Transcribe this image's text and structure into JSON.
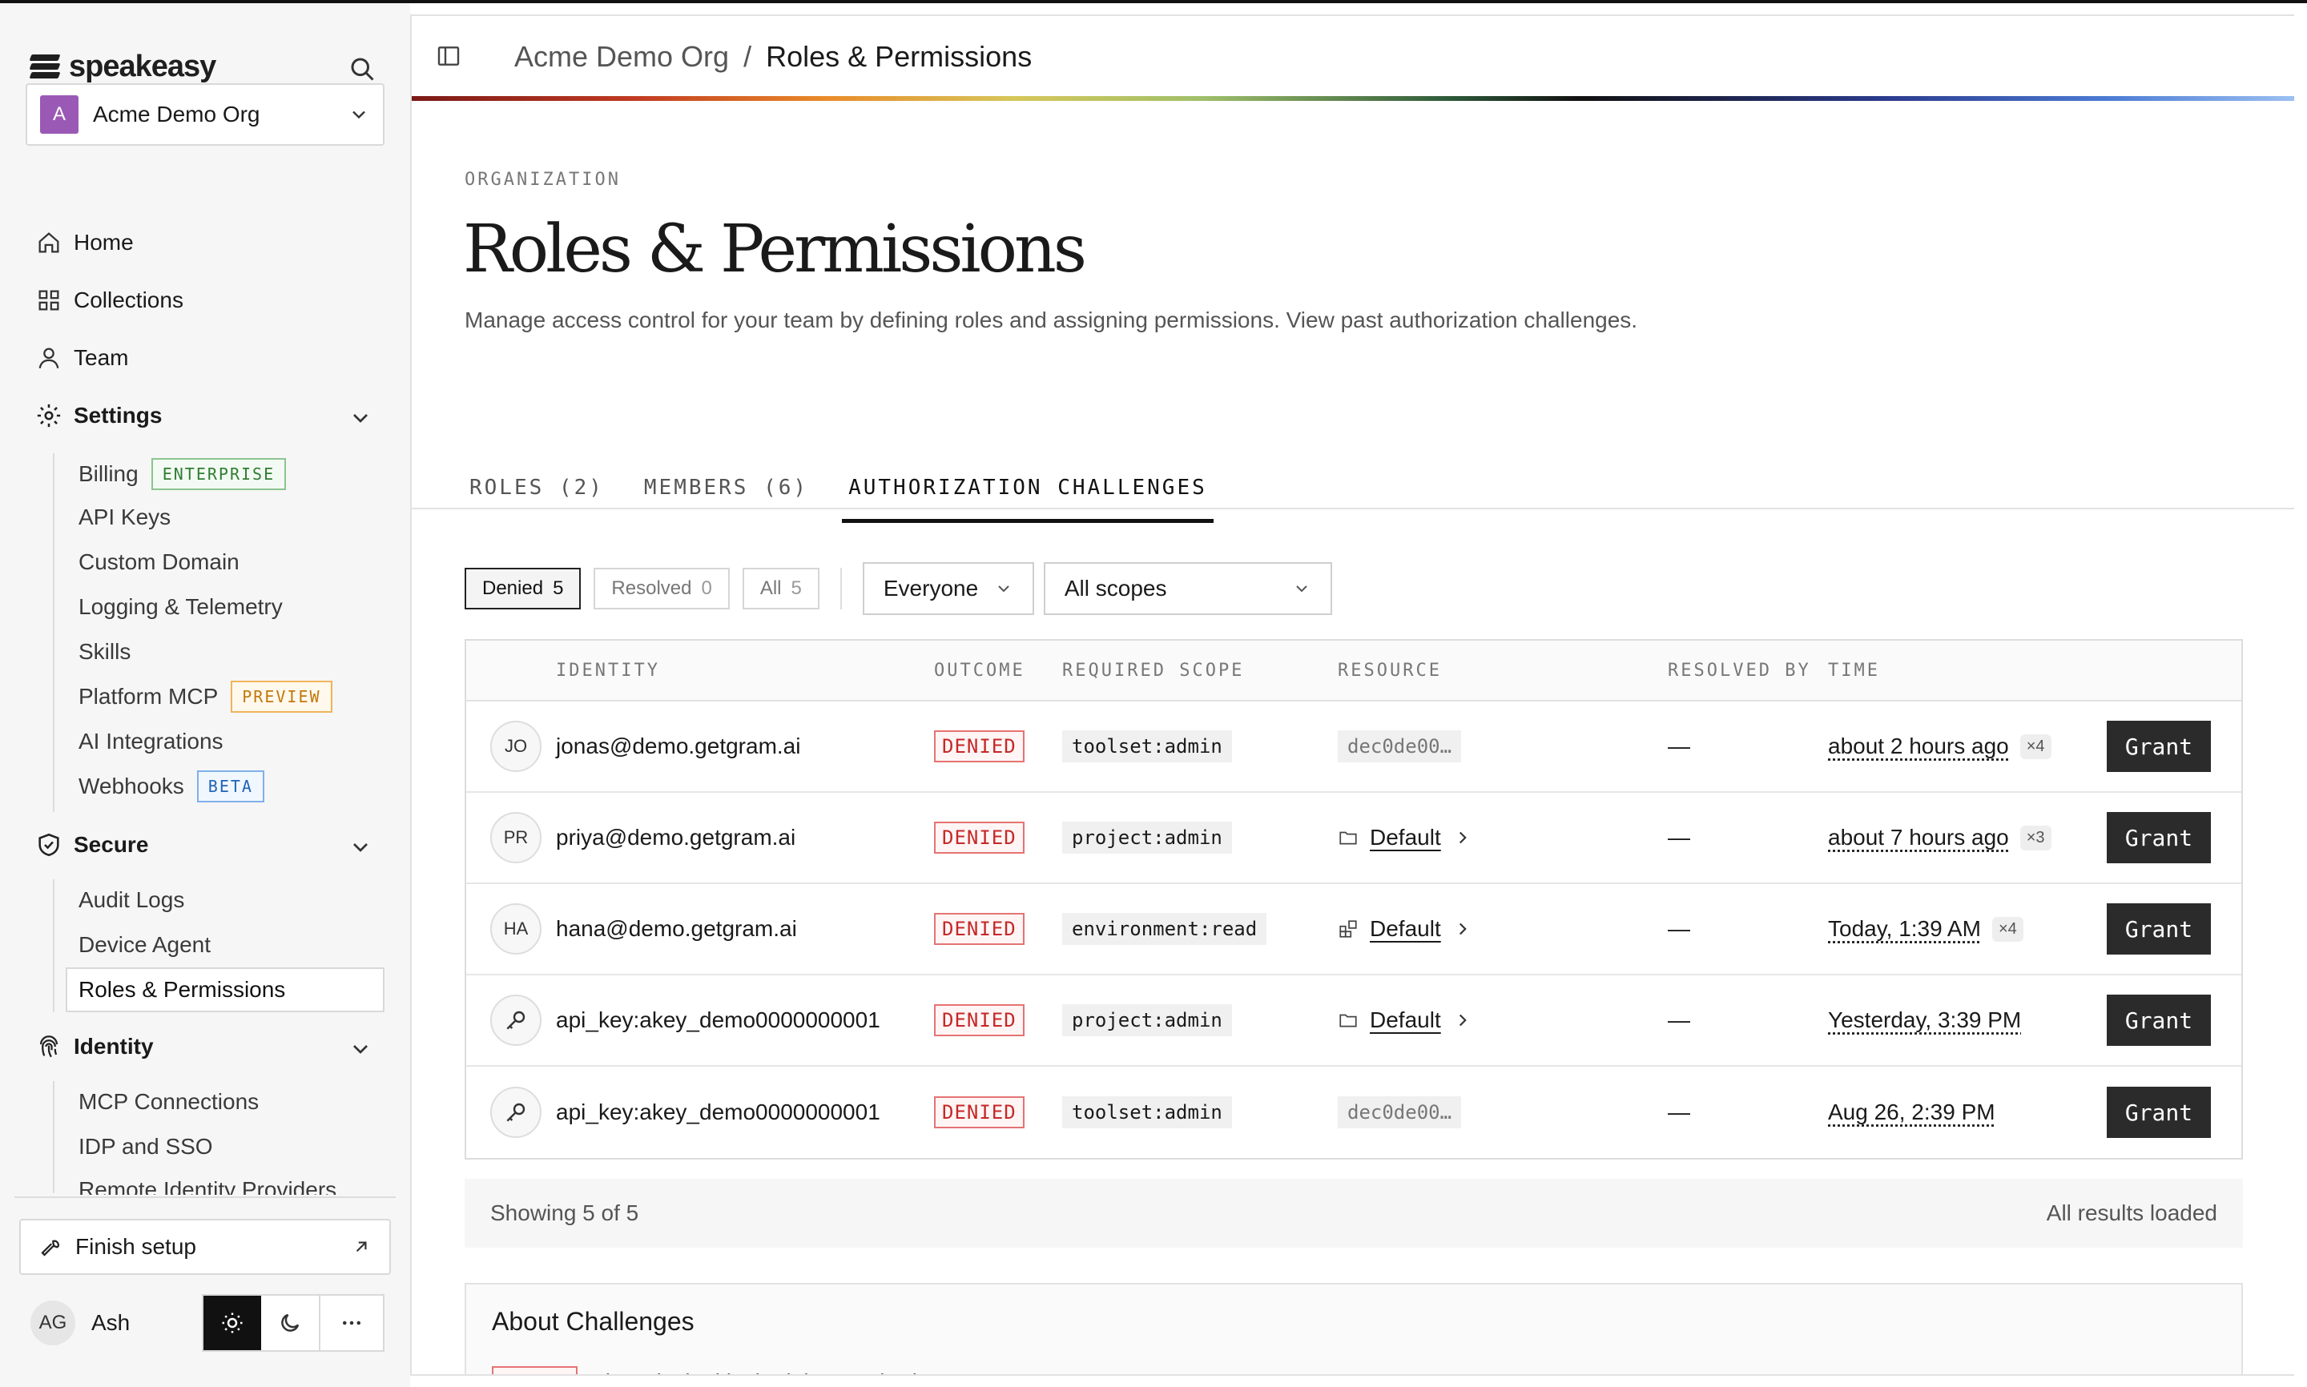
{
  "sidebar": {
    "logo_text": "speakeasy",
    "org": {
      "initial": "A",
      "name": "Acme Demo Org"
    },
    "nav": [
      {
        "label": "Home",
        "icon": "home-icon"
      },
      {
        "label": "Collections",
        "icon": "grid-icon"
      },
      {
        "label": "Team",
        "icon": "user-icon"
      }
    ],
    "settings": {
      "label": "Settings",
      "items": [
        {
          "label": "Billing",
          "badge": "ENTERPRISE"
        },
        {
          "label": "API Keys"
        },
        {
          "label": "Custom Domain"
        },
        {
          "label": "Logging & Telemetry"
        },
        {
          "label": "Skills"
        },
        {
          "label": "Platform MCP",
          "badge": "PREVIEW"
        },
        {
          "label": "AI Integrations"
        },
        {
          "label": "Webhooks",
          "badge": "BETA"
        }
      ]
    },
    "secure": {
      "label": "Secure",
      "items": [
        {
          "label": "Audit Logs"
        },
        {
          "label": "Device Agent"
        },
        {
          "label": "Roles & Permissions",
          "active": true
        }
      ]
    },
    "identity": {
      "label": "Identity",
      "items": [
        {
          "label": "MCP Connections"
        },
        {
          "label": "IDP and SSO"
        },
        {
          "label": "Remote Identity Providers"
        }
      ]
    },
    "finish_setup": "Finish setup",
    "user": {
      "initials": "AG",
      "name": "Ash"
    }
  },
  "header": {
    "breadcrumb": [
      "Acme Demo Org",
      "/",
      "Roles & Permissions"
    ]
  },
  "page": {
    "eyebrow": "ORGANIZATION",
    "title": "Roles & Permissions",
    "description": "Manage access control for your team by defining roles and assigning permissions. View past authorization challenges."
  },
  "tabs": [
    {
      "label": "ROLES (2)"
    },
    {
      "label": "MEMBERS (6)"
    },
    {
      "label": "AUTHORIZATION CHALLENGES",
      "active": true
    }
  ],
  "filters": {
    "status": [
      {
        "label": "Denied",
        "count": "5",
        "active": true
      },
      {
        "label": "Resolved",
        "count": "0"
      },
      {
        "label": "All",
        "count": "5"
      }
    ],
    "identity_select": "Everyone",
    "scope_select": "All scopes"
  },
  "table": {
    "columns": [
      "IDENTITY",
      "OUTCOME",
      "REQUIRED SCOPE",
      "RESOURCE",
      "RESOLVED BY",
      "TIME"
    ],
    "rows": [
      {
        "avatar": "JO",
        "identity": "jonas@demo.getgram.ai",
        "outcome": "DENIED",
        "scope": "toolset:admin",
        "resource": "dec0de00…",
        "resource_type": "hash",
        "resolved_by": "—",
        "time": "about 2 hours ago",
        "multiplier": "×4",
        "action": "Grant"
      },
      {
        "avatar": "PR",
        "identity": "priya@demo.getgram.ai",
        "outcome": "DENIED",
        "scope": "project:admin",
        "resource": "Default",
        "resource_type": "folder-icon",
        "resolved_by": "—",
        "time": "about 7 hours ago",
        "multiplier": "×3",
        "action": "Grant"
      },
      {
        "avatar": "HA",
        "identity": "hana@demo.getgram.ai",
        "outcome": "DENIED",
        "scope": "environment:read",
        "resource": "Default",
        "resource_type": "environment-icon",
        "resolved_by": "—",
        "time": "Today, 1:39 AM",
        "multiplier": "×4",
        "action": "Grant"
      },
      {
        "avatar": "key-icon",
        "identity": "api_key:akey_demo0000000001",
        "outcome": "DENIED",
        "scope": "project:admin",
        "resource": "Default",
        "resource_type": "folder-icon",
        "resolved_by": "—",
        "time": "Yesterday, 3:39 PM",
        "multiplier": "",
        "action": "Grant"
      },
      {
        "avatar": "key-icon",
        "identity": "api_key:akey_demo0000000001",
        "outcome": "DENIED",
        "scope": "toolset:admin",
        "resource": "dec0de00…",
        "resource_type": "hash",
        "resolved_by": "—",
        "time": "Aug 26, 2:39 PM",
        "multiplier": "",
        "action": "Grant"
      }
    ],
    "footer_left": "Showing 5 of 5",
    "footer_right": "All results loaded"
  },
  "about": {
    "title": "About Challenges",
    "badge": "DENIED",
    "text": "The principal lacked the required scope"
  }
}
